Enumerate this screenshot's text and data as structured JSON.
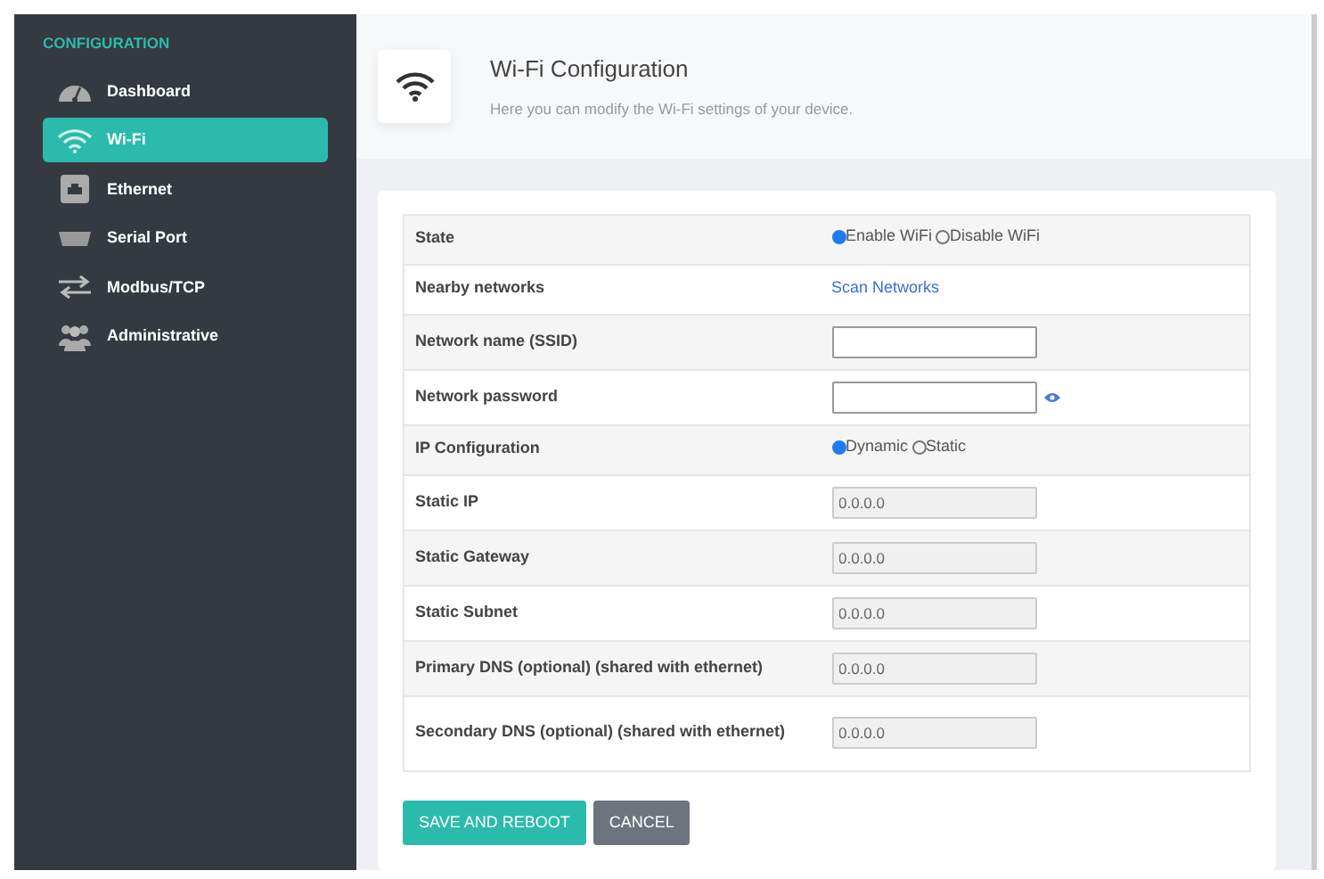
{
  "sidebar": {
    "heading": "CONFIGURATION",
    "items": [
      {
        "label": "Dashboard",
        "selected": false
      },
      {
        "label": "Wi-Fi",
        "selected": true
      },
      {
        "label": "Ethernet",
        "selected": false
      },
      {
        "label": "Serial Port",
        "selected": false
      },
      {
        "label": "Modbus/TCP",
        "selected": false
      },
      {
        "label": "Administrative",
        "selected": false
      }
    ]
  },
  "header": {
    "title": "Wi-Fi Configuration",
    "subtitle": "Here you can modify the Wi-Fi settings of your device."
  },
  "form": {
    "rows": [
      {
        "kind": "radio",
        "label": "State",
        "options": [
          {
            "label": "Enable WiFi",
            "selected": true
          },
          {
            "label": "Disable WiFi",
            "selected": false
          }
        ]
      },
      {
        "kind": "link",
        "label": "Nearby networks",
        "link": "Scan Networks"
      },
      {
        "kind": "text",
        "label": "Network name (SSID)",
        "disabled": false
      },
      {
        "kind": "password",
        "label": "Network password",
        "disabled": false
      },
      {
        "kind": "radio",
        "label": "IP Configuration",
        "options": [
          {
            "label": "Dynamic",
            "selected": true
          },
          {
            "label": "Static",
            "selected": false
          }
        ]
      },
      {
        "kind": "text",
        "label": "Static IP",
        "value": "0.0.0.0",
        "disabled": true
      },
      {
        "kind": "text",
        "label": "Static Gateway",
        "value": "0.0.0.0",
        "disabled": true
      },
      {
        "kind": "text",
        "label": "Static Subnet",
        "value": "0.0.0.0",
        "disabled": true
      },
      {
        "kind": "text",
        "label": "Primary DNS (optional) (shared with ethernet)",
        "value": "0.0.0.0",
        "disabled": true
      },
      {
        "kind": "text",
        "label": "Secondary DNS (optional) (shared with ethernet)",
        "value": "0.0.0.0",
        "disabled": true
      }
    ],
    "buttons": [
      {
        "kind": "primary",
        "label": "SAVE AND REBOOT"
      },
      {
        "kind": "secondary",
        "label": "CANCEL"
      }
    ]
  }
}
